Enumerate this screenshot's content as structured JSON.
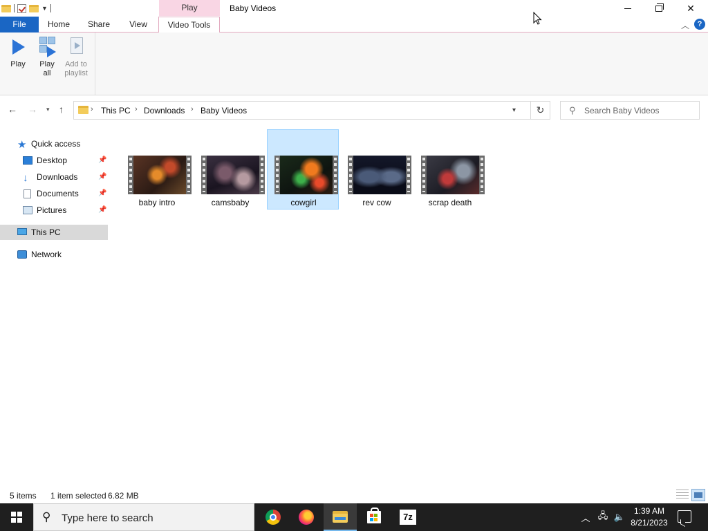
{
  "window": {
    "title": "Baby Videos",
    "context_tab_group": "Play"
  },
  "tabs": {
    "file": "File",
    "home": "Home",
    "share": "Share",
    "view": "View",
    "video_tools": "Video Tools"
  },
  "ribbon": {
    "play": "Play",
    "play_all_line1": "Play",
    "play_all_line2": "all",
    "add_line1": "Add to",
    "add_line2": "playlist"
  },
  "address": {
    "crumbs": [
      "This PC",
      "Downloads",
      "Baby Videos"
    ]
  },
  "search": {
    "placeholder": "Search Baby Videos"
  },
  "nav_pane": {
    "quick_access": "Quick access",
    "items": [
      {
        "label": "Desktop",
        "icon": "desktop-icon",
        "pinned": true
      },
      {
        "label": "Downloads",
        "icon": "downloads-icon",
        "pinned": true
      },
      {
        "label": "Documents",
        "icon": "documents-icon",
        "pinned": true
      },
      {
        "label": "Pictures",
        "icon": "pictures-icon",
        "pinned": true
      }
    ],
    "this_pc": "This PC",
    "network": "Network"
  },
  "files": [
    {
      "name": "baby intro",
      "selected": false
    },
    {
      "name": "camsbaby",
      "selected": false
    },
    {
      "name": "cowgirl",
      "selected": true
    },
    {
      "name": "rev cow",
      "selected": false
    },
    {
      "name": "scrap death",
      "selected": false
    }
  ],
  "status": {
    "count": "5 items",
    "selection": "1 item selected",
    "size": "6.82 MB"
  },
  "taskbar": {
    "search_text": "Type here to search",
    "apps": [
      "chrome-icon",
      "firefox-icon",
      "file-explorer-icon",
      "store-icon",
      "7zip-icon"
    ],
    "sevenzip_label": "7z",
    "time": "1:39 AM",
    "date": "8/21/2023"
  },
  "colors": {
    "accent": "#1a66c4",
    "selection": "#cce8ff",
    "context_tab": "#f9d6e4",
    "taskbar": "#1f1f1f"
  }
}
